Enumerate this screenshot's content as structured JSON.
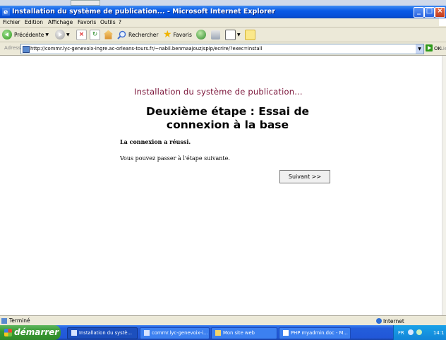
{
  "window": {
    "title": "Installation du système de publication... - Microsoft Internet Explorer"
  },
  "menu": [
    "Fichier",
    "Edition",
    "Affichage",
    "Favoris",
    "Outils",
    "?"
  ],
  "toolbar": {
    "back_label": "Précédente",
    "search_label": "Rechercher",
    "favorites_label": "Favoris"
  },
  "address": {
    "label": "Adresse",
    "url": "http://commr.lyc-genevoix-ingre.ac-orleans-tours.fr/~nabil.benmaajouz/spip/ecrire/?exec=install",
    "go_label": "OK",
    "links_label": "Lie"
  },
  "page": {
    "heading": "Installation du système de publication...",
    "step_title": "Deuxième étape : Essai de connexion à la base",
    "success_text": "La connexion a réussi.",
    "next_text": "Vous pouvez passer à l'étape suivante.",
    "next_button": "Suivant >>"
  },
  "status": {
    "text": "Terminé",
    "zone": "Internet"
  },
  "taskbar": {
    "start_label": "démarrer",
    "tasks": [
      {
        "label": "Installation du systè..."
      },
      {
        "label": "commr.lyc-genevoix-i..."
      },
      {
        "label": "Mon site web"
      },
      {
        "label": "PHP myadmin.doc - M..."
      }
    ],
    "lang": "FR",
    "clock": "14:1"
  },
  "colors": {
    "heading": "#7a1338",
    "titlebar": "#0a5ae6",
    "taskbar": "#245edb",
    "start": "#3a9a34"
  }
}
